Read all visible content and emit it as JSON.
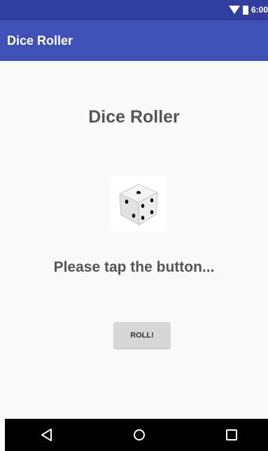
{
  "status_bar": {
    "time": "6:00",
    "icons": [
      "wifi-icon",
      "battery-icon"
    ],
    "color": "#303f9f"
  },
  "app_bar": {
    "title": "Dice Roller",
    "color": "#3f51b5"
  },
  "main": {
    "heading": "Dice Roller",
    "dice_image": "dice-icon",
    "prompt": "Please tap the button...",
    "roll_button_label": "ROLL!"
  },
  "nav_bar": {
    "icons": [
      "back-icon",
      "home-icon",
      "recents-icon"
    ]
  }
}
